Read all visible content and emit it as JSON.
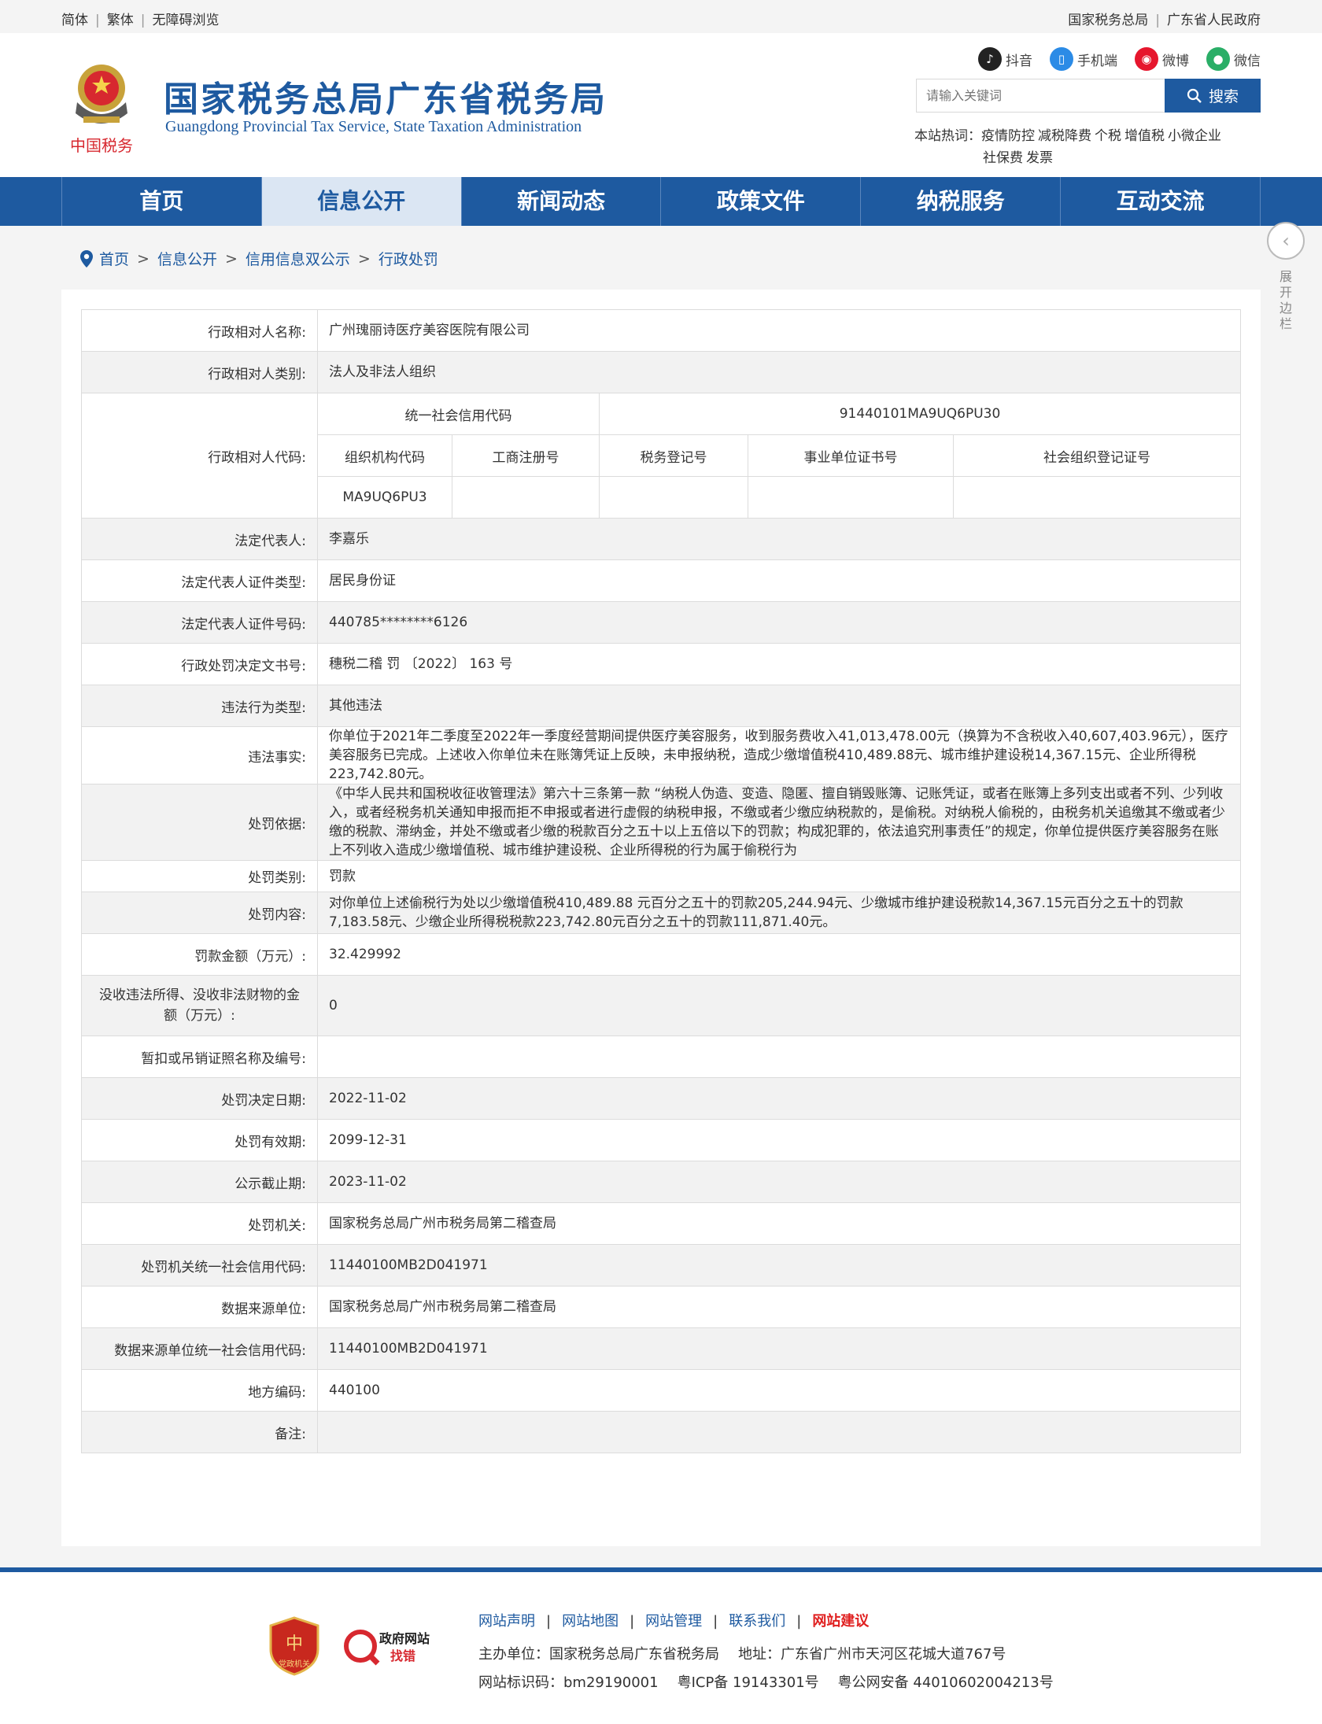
{
  "topbar": {
    "left": [
      "简体",
      "繁体",
      "无障碍浏览"
    ],
    "right": [
      "国家税务总局",
      "广东省人民政府"
    ]
  },
  "header": {
    "emblem_text": "中国税务",
    "title": "国家税务总局广东省税务局",
    "subtitle": "Guangdong Provincial Tax Service, State Taxation Administration",
    "social": [
      {
        "label": "抖音",
        "icon": "tiktok-icon",
        "color": "#222222"
      },
      {
        "label": "手机端",
        "icon": "mobile-icon",
        "color": "#2b8be6"
      },
      {
        "label": "微博",
        "icon": "weibo-icon",
        "color": "#e6162d"
      },
      {
        "label": "微信",
        "icon": "wechat-icon",
        "color": "#2aae67"
      }
    ],
    "search_placeholder": "请输入关键词",
    "search_button": "搜索",
    "hot_label": "本站热词：",
    "hot_words": [
      "疫情防控",
      "减税降费",
      "个税",
      "增值税",
      "小微企业",
      "社保费",
      "发票"
    ]
  },
  "nav": [
    "首页",
    "信息公开",
    "新闻动态",
    "政策文件",
    "纳税服务",
    "互动交流"
  ],
  "nav_active": 1,
  "breadcrumb": [
    "首页",
    "信息公开",
    "信用信息双公示",
    "行政处罚"
  ],
  "side_toggle": "展开边栏",
  "record": {
    "name_label": "行政相对人名称:",
    "name": "广州瑰丽诗医疗美容医院有限公司",
    "category_label": "行政相对人类别:",
    "category": "法人及非法人组织",
    "code_label": "行政相对人代码:",
    "uscc_label": "统一社会信用代码",
    "uscc": "91440101MA9UQ6PU30",
    "code_headers": [
      "组织机构代码",
      "工商注册号",
      "税务登记号",
      "事业单位证书号",
      "社会组织登记证号"
    ],
    "code_values": [
      "MA9UQ6PU3",
      "",
      "",
      "",
      ""
    ],
    "rows": [
      {
        "k": "法定代表人:",
        "v": "李嘉乐"
      },
      {
        "k": "法定代表人证件类型:",
        "v": "居民身份证"
      },
      {
        "k": "法定代表人证件号码:",
        "v": "440785********6126"
      },
      {
        "k": "行政处罚决定文书号:",
        "v": "穗税二稽 罚 〔2022〕 163 号"
      },
      {
        "k": "违法行为类型:",
        "v": "其他违法"
      },
      {
        "k": "违法事实:",
        "v": "你单位于2021年二季度至2022年一季度经营期间提供医疗美容服务，收到服务费收入41,013,478.00元（换算为不含税收入40,607,403.96元），医疗美容服务已完成。上述收入你单位未在账簿凭证上反映，未申报纳税，造成少缴增值税410,489.88元、城市维护建设税14,367.15元、企业所得税223,742.80元。"
      },
      {
        "k": "处罚依据:",
        "v": "《中华人民共和国税收征收管理法》第六十三条第一款 “纳税人伪造、变造、隐匿、擅自销毁账簿、记账凭证，或者在账簿上多列支出或者不列、少列收入，或者经税务机关通知申报而拒不申报或者进行虚假的纳税申报，不缴或者少缴应纳税款的，是偷税。对纳税人偷税的，由税务机关追缴其不缴或者少缴的税款、滞纳金，并处不缴或者少缴的税款百分之五十以上五倍以下的罚款；构成犯罪的，依法追究刑事责任”的规定，你单位提供医疗美容服务在账上不列收入造成少缴增值税、城市维护建设税、企业所得税的行为属于偷税行为"
      },
      {
        "k": "处罚类别:",
        "v": "罚款"
      },
      {
        "k": "处罚内容:",
        "v": "对你单位上述偷税行为处以少缴增值税410,489.88 元百分之五十的罚款205,244.94元、少缴城市维护建设税款14,367.15元百分之五十的罚款7,183.58元、少缴企业所得税税款223,742.80元百分之五十的罚款111,871.40元。"
      },
      {
        "k": "罚款金额（万元）:",
        "v": "32.429992"
      },
      {
        "k": "没收违法所得、没收非法财物的金额（万元）:",
        "v": "0"
      },
      {
        "k": "暂扣或吊销证照名称及编号:",
        "v": ""
      },
      {
        "k": "处罚决定日期:",
        "v": "2022-11-02"
      },
      {
        "k": "处罚有效期:",
        "v": "2099-12-31"
      },
      {
        "k": "公示截止期:",
        "v": "2023-11-02"
      },
      {
        "k": "处罚机关:",
        "v": "国家税务总局广州市税务局第二稽查局"
      },
      {
        "k": "处罚机关统一社会信用代码:",
        "v": "11440100MB2D041971"
      },
      {
        "k": "数据来源单位:",
        "v": "国家税务总局广州市税务局第二稽查局"
      },
      {
        "k": "数据来源单位统一社会信用代码:",
        "v": "11440100MB2D041971"
      },
      {
        "k": "地方编码:",
        "v": "440100"
      },
      {
        "k": "备注:",
        "v": ""
      }
    ]
  },
  "footer": {
    "links": [
      "网站声明",
      "网站地图",
      "网站管理",
      "联系我们",
      "网站建议"
    ],
    "host": "主办单位：国家税务总局广东省税务局",
    "address": "地址：广东省广州市天河区花城大道767号",
    "site_id": "网站标识码：bm29190001",
    "icp": "粤ICP备 19143301号",
    "police": "粤公网安备 44010602004213号",
    "badge1_text": "党政机关",
    "badge2_title": "政府网站",
    "badge2_sub": "找错"
  }
}
